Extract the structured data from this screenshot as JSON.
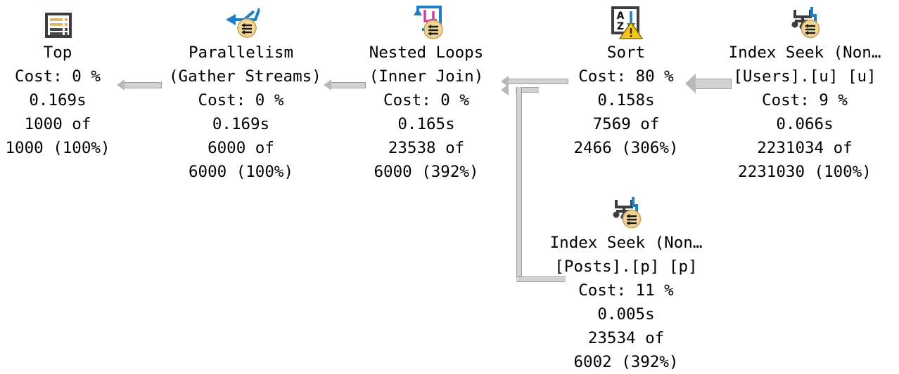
{
  "diagram": {
    "kind": "sql-execution-plan",
    "colors": {
      "connector_fill": "#d2d2d2",
      "connector_stroke": "#9c9c9c",
      "badge_fill": "#f0d498",
      "badge_stroke": "#c8a04e",
      "parallel_arrow": "#1f7fc4",
      "loop_pink": "#cc3fa8",
      "warning_yellow": "#f5c518",
      "icon_dark": "#3d3d3d",
      "top_bar_gold": "#e2b66e",
      "background": "#ffffff",
      "text": "#000000"
    },
    "nodes": [
      {
        "id": "top",
        "icon": "top-list-icon",
        "lines": [
          "Top",
          "Cost: 0 %",
          "0.169s",
          "1000 of",
          "1000 (100%)"
        ],
        "operation": "Top",
        "cost_percent": "0 %",
        "elapsed": "0.169s",
        "actual_rows": "1000",
        "estimated_rows": "1000",
        "rows_percent": "100%"
      },
      {
        "id": "parallelism",
        "icon": "parallelism-gather-streams-icon",
        "lines": [
          "Parallelism",
          "(Gather Streams)",
          "Cost: 0 %",
          "0.169s",
          "6000 of",
          "6000 (100%)"
        ],
        "operation": "Parallelism",
        "subtitle": "(Gather Streams)",
        "cost_percent": "0 %",
        "elapsed": "0.169s",
        "actual_rows": "6000",
        "estimated_rows": "6000",
        "rows_percent": "100%"
      },
      {
        "id": "nested-loops",
        "icon": "nested-loops-icon",
        "lines": [
          "Nested Loops",
          "(Inner Join)",
          "Cost: 0 %",
          "0.165s",
          "23538 of",
          "6000 (392%)"
        ],
        "operation": "Nested Loops",
        "subtitle": "(Inner Join)",
        "cost_percent": "0 %",
        "elapsed": "0.165s",
        "actual_rows": "23538",
        "estimated_rows": "6000",
        "rows_percent": "392%"
      },
      {
        "id": "sort",
        "icon": "sort-az-warning-icon",
        "lines": [
          "Sort",
          "Cost: 80 %",
          "0.158s",
          "7569 of",
          "2466 (306%)"
        ],
        "operation": "Sort",
        "cost_percent": "80 %",
        "elapsed": "0.158s",
        "actual_rows": "7569",
        "estimated_rows": "2466",
        "rows_percent": "306%",
        "has_warning": true
      },
      {
        "id": "index-seek-users",
        "icon": "index-seek-icon",
        "lines": [
          "Index Seek (Non…",
          "[Users].[u] [u]",
          "Cost: 9 %",
          "0.066s",
          "2231034 of",
          "2231030 (100%)"
        ],
        "operation": "Index Seek (Non…",
        "object": "[Users].[u] [u]",
        "cost_percent": "9 %",
        "elapsed": "0.066s",
        "actual_rows": "2231034",
        "estimated_rows": "2231030",
        "rows_percent": "100%"
      },
      {
        "id": "index-seek-posts",
        "icon": "index-seek-icon",
        "lines": [
          "Index Seek (Non…",
          "[Posts].[p] [p]",
          "Cost: 11 %",
          "0.005s",
          "23534 of",
          "6002 (392%)"
        ],
        "operation": "Index Seek (Non…",
        "object": "[Posts].[p] [p]",
        "cost_percent": "11 %",
        "elapsed": "0.005s",
        "actual_rows": "23534",
        "estimated_rows": "6002",
        "rows_percent": "392%"
      }
    ],
    "connectors": [
      {
        "id": "parallelism-to-top",
        "from": "parallelism",
        "to": "top",
        "direction": "left",
        "thickness": "thin"
      },
      {
        "id": "nested-loops-to-parallelism",
        "from": "nested-loops",
        "to": "parallelism",
        "direction": "left",
        "thickness": "thin"
      },
      {
        "id": "sort-to-nested-loops",
        "from": "sort",
        "to": "nested-loops",
        "direction": "left",
        "thickness": "thin"
      },
      {
        "id": "index-seek-users-to-sort",
        "from": "index-seek-users",
        "to": "sort",
        "direction": "left",
        "thickness": "medium"
      },
      {
        "id": "index-seek-posts-to-nested-loops",
        "from": "index-seek-posts",
        "to": "nested-loops",
        "direction": "elbow-up-left",
        "thickness": "thin"
      }
    ]
  }
}
